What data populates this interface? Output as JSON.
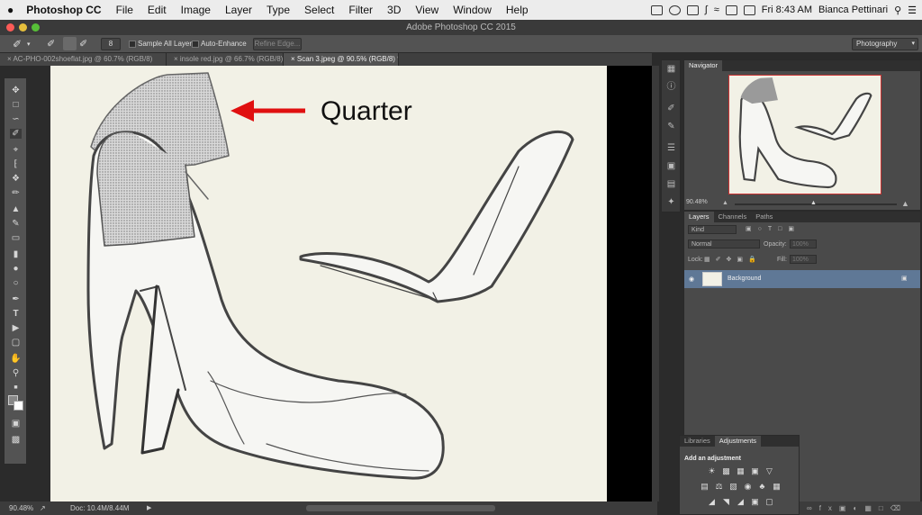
{
  "menubar": {
    "apple": "",
    "app_name": "Photoshop CC",
    "items": [
      "File",
      "Edit",
      "Image",
      "Layer",
      "Type",
      "Select",
      "Filter",
      "3D",
      "View",
      "Window",
      "Help"
    ],
    "clock": "Fri 8:43 AM",
    "user": "Bianca Pettinari"
  },
  "window": {
    "title": "Adobe Photoshop CC 2015"
  },
  "options": {
    "brush_size": "8",
    "sample_all_layers": "Sample All Layers",
    "auto_enhance": "Auto-Enhance",
    "refine_edge": "Refine Edge...",
    "workspace": "Photography"
  },
  "tabs": [
    {
      "label": "AC-PHO-002shoeflat.jpg @ 60.7% (RGB/8)"
    },
    {
      "label": "insole red.jpg @ 66.7% (RGB/8)"
    },
    {
      "label": "Scan 3.jpeg @ 90.5% (RGB/8) *"
    }
  ],
  "canvas": {
    "annotation": "Quarter",
    "arrow_color": "#e01010"
  },
  "status": {
    "zoom": "90.48%",
    "doc": "Doc: 10.4M/8.44M"
  },
  "navigator": {
    "title": "Navigator",
    "zoom": "90.48%"
  },
  "layers_panel": {
    "tabs": [
      "Layers",
      "Channels",
      "Paths"
    ],
    "kind": "Kind",
    "blend_mode": "Normal",
    "opacity_label": "Opacity:",
    "opacity_value": "100%",
    "lock_label": "Lock:",
    "fill_label": "Fill:",
    "fill_value": "100%",
    "layer_name": "Background",
    "selected_color": "#5f7896"
  },
  "adjustments": {
    "tabs": [
      "Libraries",
      "Adjustments"
    ],
    "title": "Add an adjustment"
  }
}
